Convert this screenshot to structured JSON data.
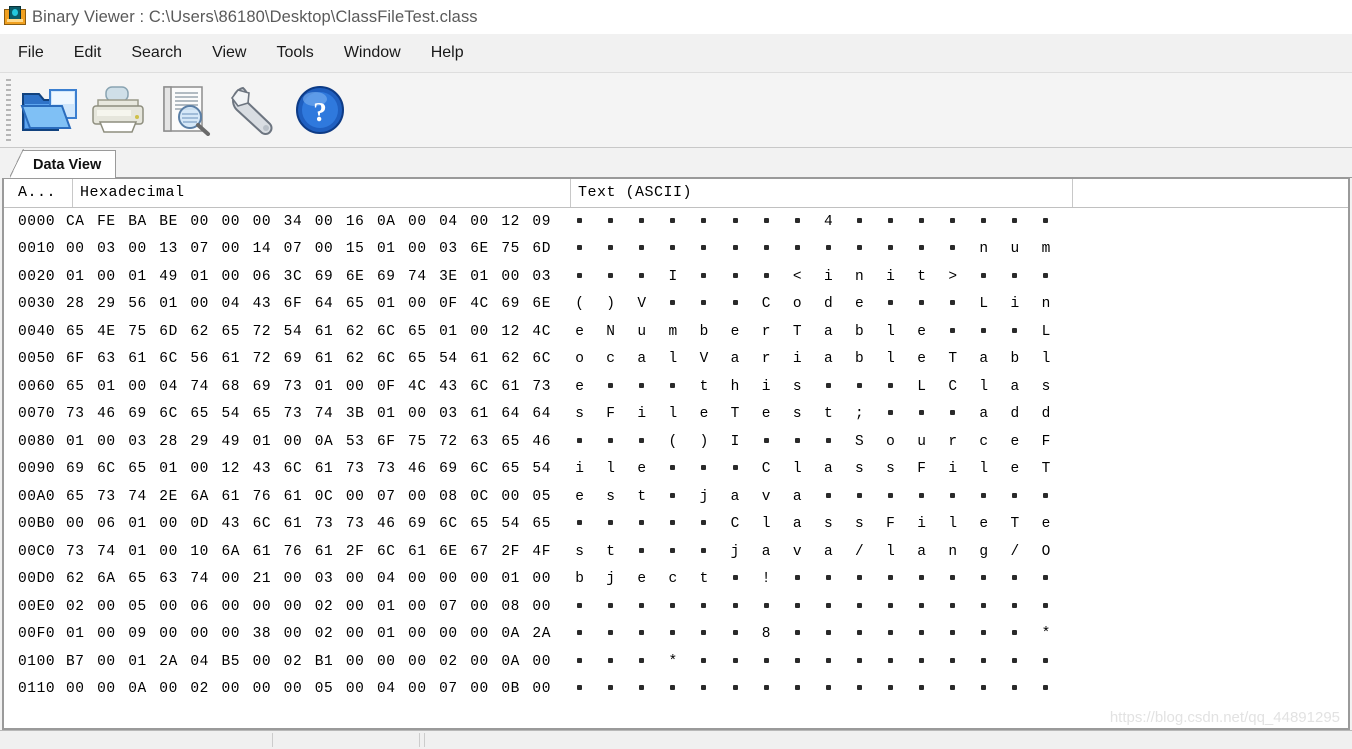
{
  "window": {
    "app_icon": "binary-viewer-icon",
    "title": "Binary Viewer : C:\\Users\\86180\\Desktop\\ClassFileTest.class"
  },
  "menubar": {
    "items": [
      {
        "label": "File"
      },
      {
        "label": "Edit"
      },
      {
        "label": "Search"
      },
      {
        "label": "View"
      },
      {
        "label": "Tools"
      },
      {
        "label": "Window"
      },
      {
        "label": "Help"
      }
    ]
  },
  "toolbar": {
    "buttons": [
      {
        "name": "open-file-icon",
        "tooltip": "Open"
      },
      {
        "name": "print-icon",
        "tooltip": "Print"
      },
      {
        "name": "print-preview-icon",
        "tooltip": "Print Preview"
      },
      {
        "name": "tools-wrench-icon",
        "tooltip": "Tools"
      },
      {
        "name": "help-question-icon",
        "tooltip": "Help"
      }
    ]
  },
  "tabs": [
    {
      "label": "Data View",
      "active": true
    }
  ],
  "data_view": {
    "headers": {
      "address": "A...",
      "hexadecimal": "Hexadecimal",
      "text": "Text (ASCII)"
    },
    "rows": [
      {
        "address": "0000",
        "hex": "CA FE BA BE 00 00 00 34 00 16 0A 00 04 00 12 09",
        "ascii": "........4......."
      },
      {
        "address": "0010",
        "hex": "00 03 00 13 07 00 14 07 00 15 01 00 03 6E 75 6D",
        "ascii": ".............num"
      },
      {
        "address": "0020",
        "hex": "01 00 01 49 01 00 06 3C 69 6E 69 74 3E 01 00 03",
        "ascii": "...I...<init>..."
      },
      {
        "address": "0030",
        "hex": "28 29 56 01 00 04 43 6F 64 65 01 00 0F 4C 69 6E",
        "ascii": "()V...Code...Lin"
      },
      {
        "address": "0040",
        "hex": "65 4E 75 6D 62 65 72 54 61 62 6C 65 01 00 12 4C",
        "ascii": "eNumberTable...L"
      },
      {
        "address": "0050",
        "hex": "6F 63 61 6C 56 61 72 69 61 62 6C 65 54 61 62 6C",
        "ascii": "ocalVariableTabl"
      },
      {
        "address": "0060",
        "hex": "65 01 00 04 74 68 69 73 01 00 0F 4C 43 6C 61 73",
        "ascii": "e...this...LClas"
      },
      {
        "address": "0070",
        "hex": "73 46 69 6C 65 54 65 73 74 3B 01 00 03 61 64 64",
        "ascii": "sFileTest;...add"
      },
      {
        "address": "0080",
        "hex": "01 00 03 28 29 49 01 00 0A 53 6F 75 72 63 65 46",
        "ascii": "...()I...SourceF"
      },
      {
        "address": "0090",
        "hex": "69 6C 65 01 00 12 43 6C 61 73 73 46 69 6C 65 54",
        "ascii": "ile...ClassFileT"
      },
      {
        "address": "00A0",
        "hex": "65 73 74 2E 6A 61 76 61 0C 00 07 00 08 0C 00 05",
        "ascii": "est.java........"
      },
      {
        "address": "00B0",
        "hex": "00 06 01 00 0D 43 6C 61 73 73 46 69 6C 65 54 65",
        "ascii": ".....ClassFileTe"
      },
      {
        "address": "00C0",
        "hex": "73 74 01 00 10 6A 61 76 61 2F 6C 61 6E 67 2F 4F",
        "ascii": "st...java/lang/O"
      },
      {
        "address": "00D0",
        "hex": "62 6A 65 63 74 00 21 00 03 00 04 00 00 00 01 00",
        "ascii": "bject.!........."
      },
      {
        "address": "00E0",
        "hex": "02 00 05 00 06 00 00 00 02 00 01 00 07 00 08 00",
        "ascii": "................"
      },
      {
        "address": "00F0",
        "hex": "01 00 09 00 00 00 38 00 02 00 01 00 00 00 0A 2A",
        "ascii": "......8........*"
      },
      {
        "address": "0100",
        "hex": "B7 00 01 2A 04 B5 00 02 B1 00 00 00 02 00 0A 00",
        "ascii": "...*............"
      },
      {
        "address": "0110",
        "hex": "00 00 0A 00 02 00 00 00 05 00 04 00 07 00 0B 00",
        "ascii": "................"
      }
    ],
    "nonprintable_glyph": "."
  },
  "watermark": {
    "text": "https://blog.csdn.net/qq_44891295"
  },
  "colors": {
    "title_text": "#5a5a5a",
    "menu_text": "#1a1a1a",
    "panel_bg": "#ffffff",
    "chrome_bg": "#f1f1f1",
    "border": "#9a9a9a",
    "watermark": "#e2e2e2"
  }
}
